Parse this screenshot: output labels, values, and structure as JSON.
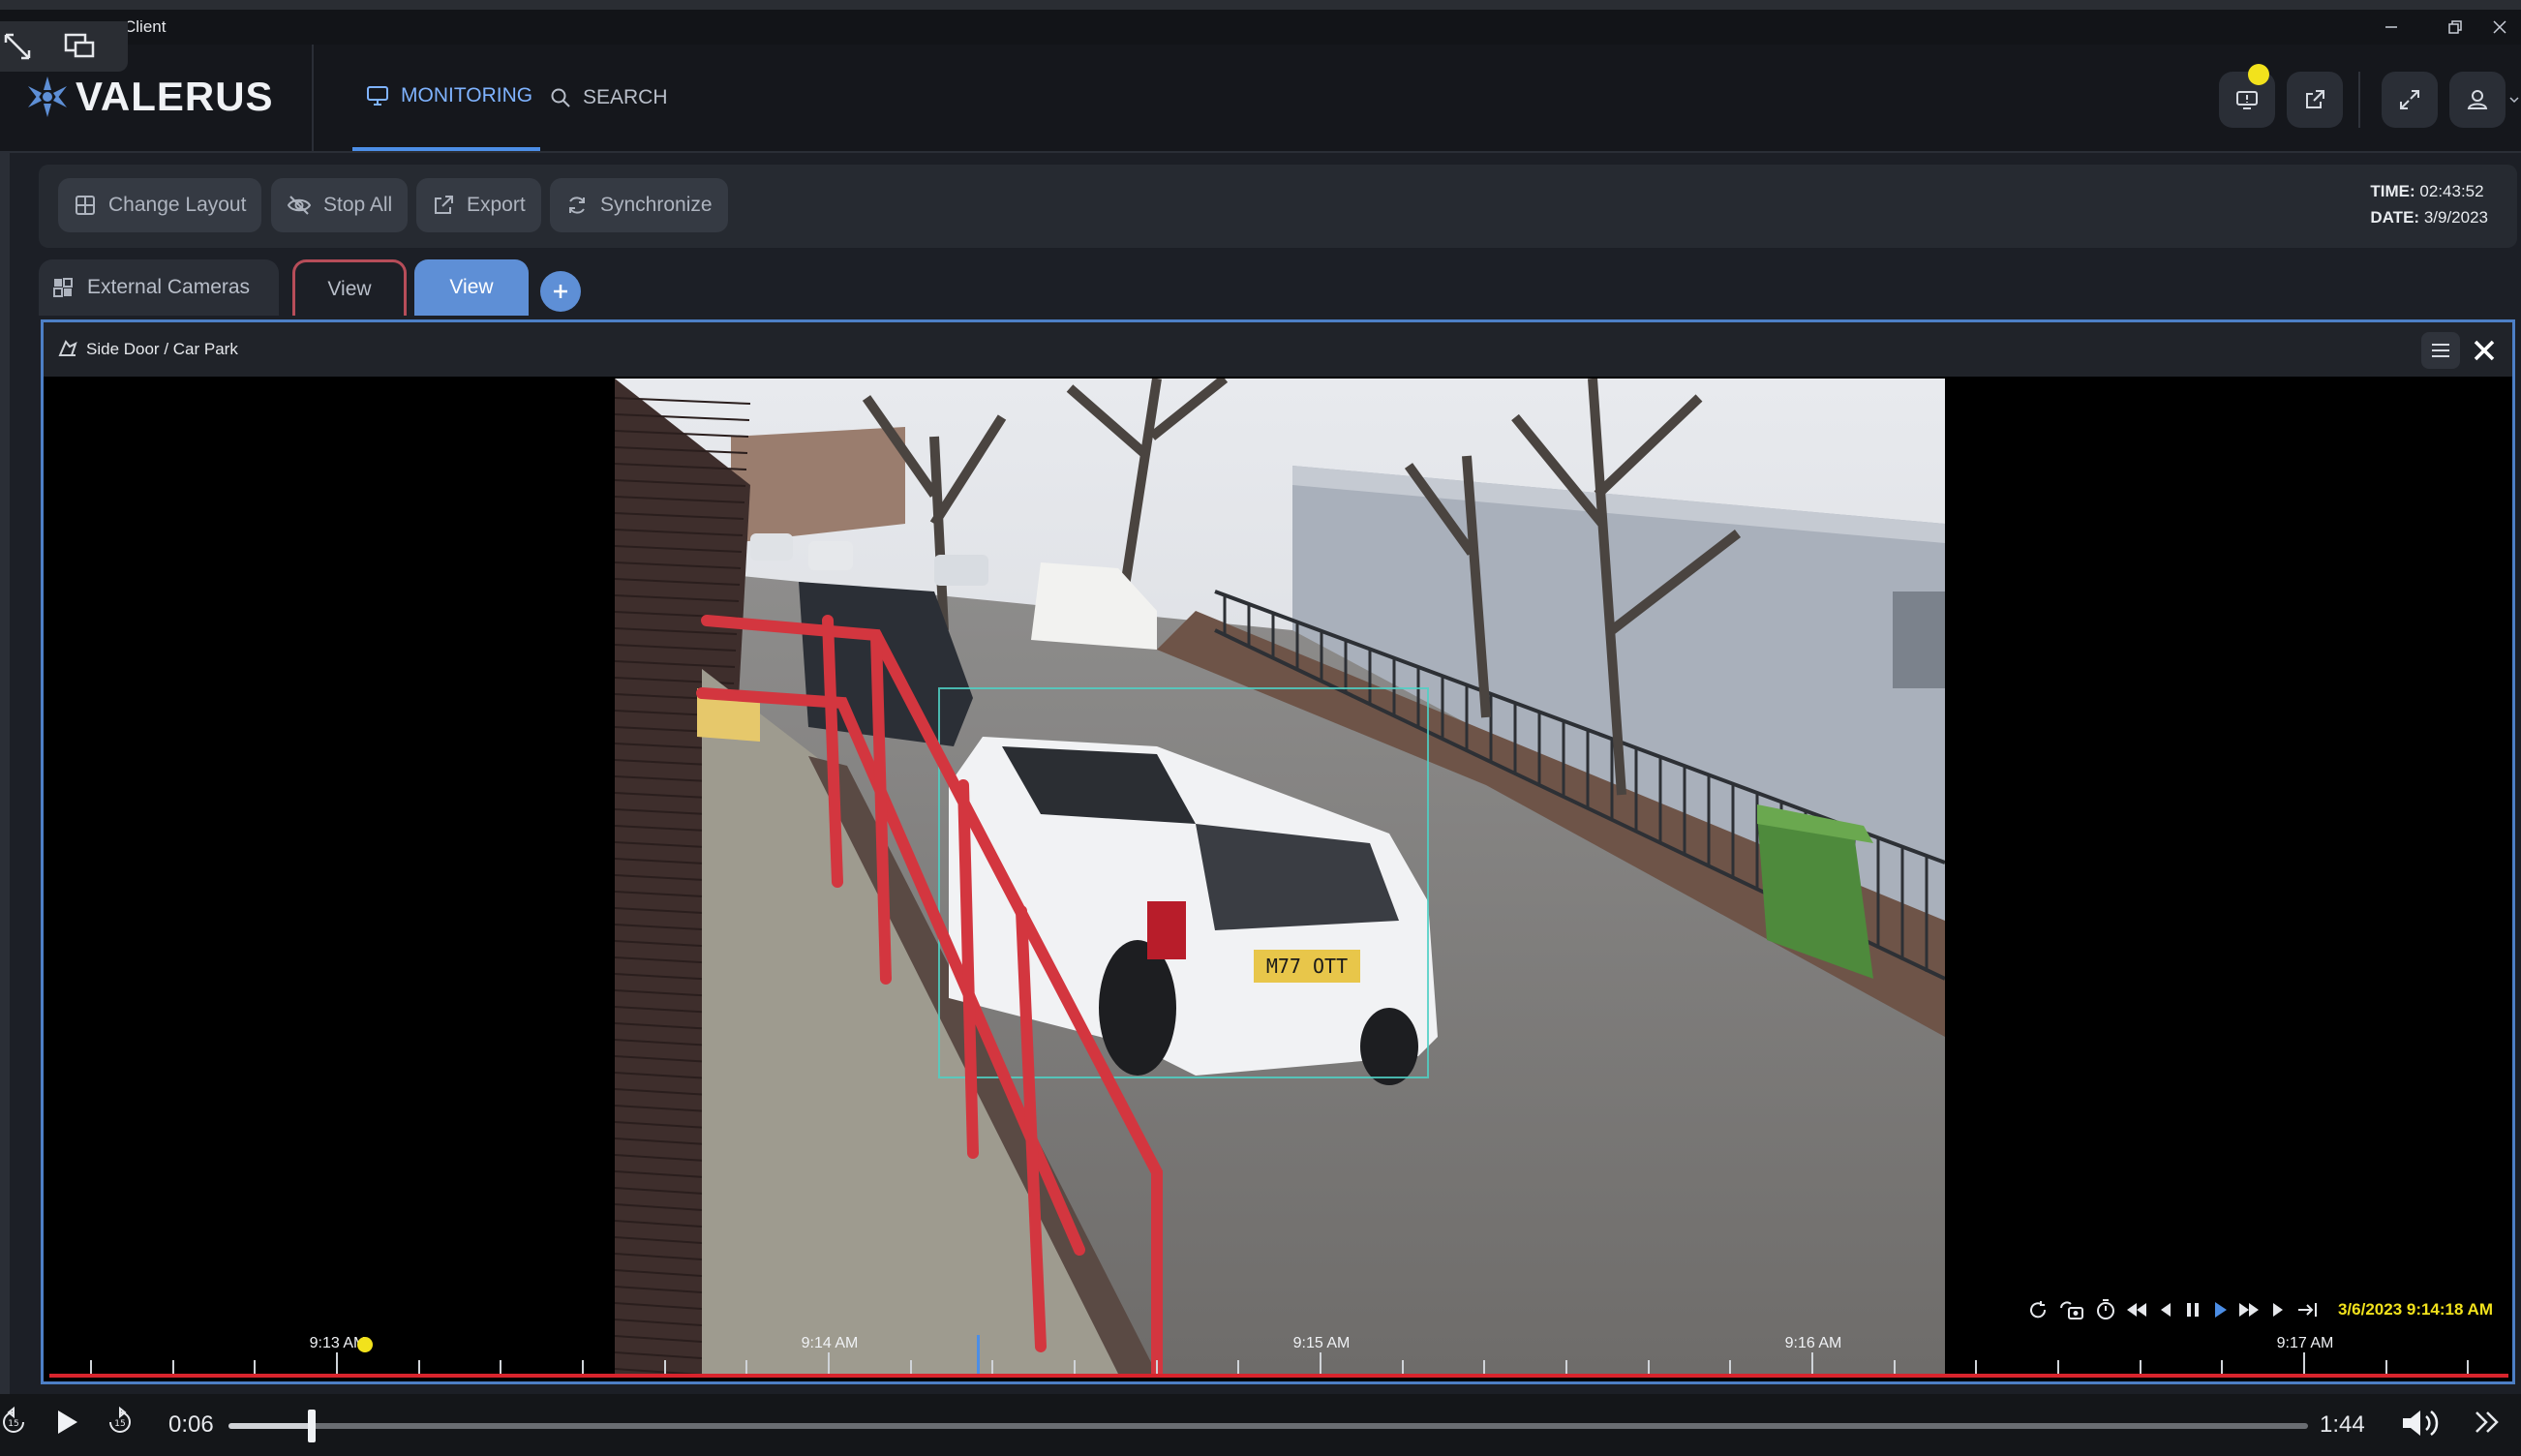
{
  "window": {
    "title": "Client"
  },
  "header": {
    "logo": "VALERUS",
    "nav": [
      {
        "label": "MONITORING",
        "icon": "monitor-icon",
        "active": true
      },
      {
        "label": "SEARCH",
        "icon": "search-icon",
        "active": false
      }
    ]
  },
  "toolbar": {
    "change_layout": "Change Layout",
    "stop_all": "Stop All",
    "export": "Export",
    "synchronize": "Synchronize",
    "time_label": "TIME:",
    "time_value": "02:43:52",
    "date_label": "DATE:",
    "date_value": "3/9/2023"
  },
  "tabs": {
    "external_cameras": "External Cameras",
    "view_1": "View",
    "view_2": "View"
  },
  "camera": {
    "title": "Side Door / Car Park",
    "plate": "M77 OTT",
    "timestamp": "3/6/2023 9:14:18 AM",
    "timeline_labels": [
      "9:13 AM",
      "9:14 AM",
      "9:15 AM",
      "9:16 AM",
      "9:17 AM"
    ]
  },
  "player": {
    "elapsed": "0:06",
    "remaining": "1:44",
    "progress": 0.04
  },
  "colors": {
    "accent": "#4c8ee6",
    "tab_active": "#5e8fd6",
    "timeline": "#d8242d",
    "marker": "#f2e21c"
  }
}
